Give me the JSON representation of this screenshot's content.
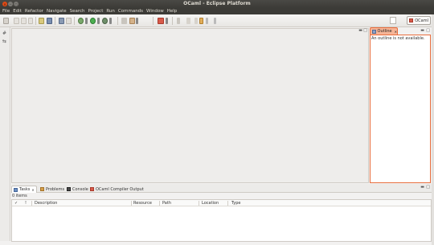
{
  "window": {
    "title": "OCaml - Eclipse Platform",
    "close_glyph": "×",
    "minimize_glyph": "−",
    "maximize_glyph": "□"
  },
  "menu": [
    "File",
    "Edit",
    "Refactor",
    "Navigate",
    "Search",
    "Project",
    "Run",
    "Commands",
    "Window",
    "Help"
  ],
  "perspective": {
    "label": "OCaml"
  },
  "outline": {
    "tab_label": "Outline",
    "tab_close": "✕",
    "message": "An outline is not available.",
    "minimize_glyph": "▬",
    "maximize_glyph": "□"
  },
  "editor_controls": {
    "minimize_glyph": "▬",
    "maximize_glyph": "□"
  },
  "bottom": {
    "tabs": [
      {
        "label": "Tasks",
        "close": "✕"
      },
      {
        "label": "Problems"
      },
      {
        "label": "Console"
      },
      {
        "label": "OCaml Compiler Output"
      }
    ],
    "items_count": "0 items",
    "columns": [
      "!",
      "Description",
      "Resource",
      "Path",
      "Location",
      "Type"
    ],
    "check_glyph": "✓",
    "minimize_glyph": "▬",
    "maximize_glyph": "□"
  },
  "left_trim": {
    "icon1": "#",
    "icon2": "⇆"
  },
  "colors": {
    "accent": "#e86d3d",
    "titlebar": "#3c3b37",
    "outline_tab": "#f6b597"
  }
}
